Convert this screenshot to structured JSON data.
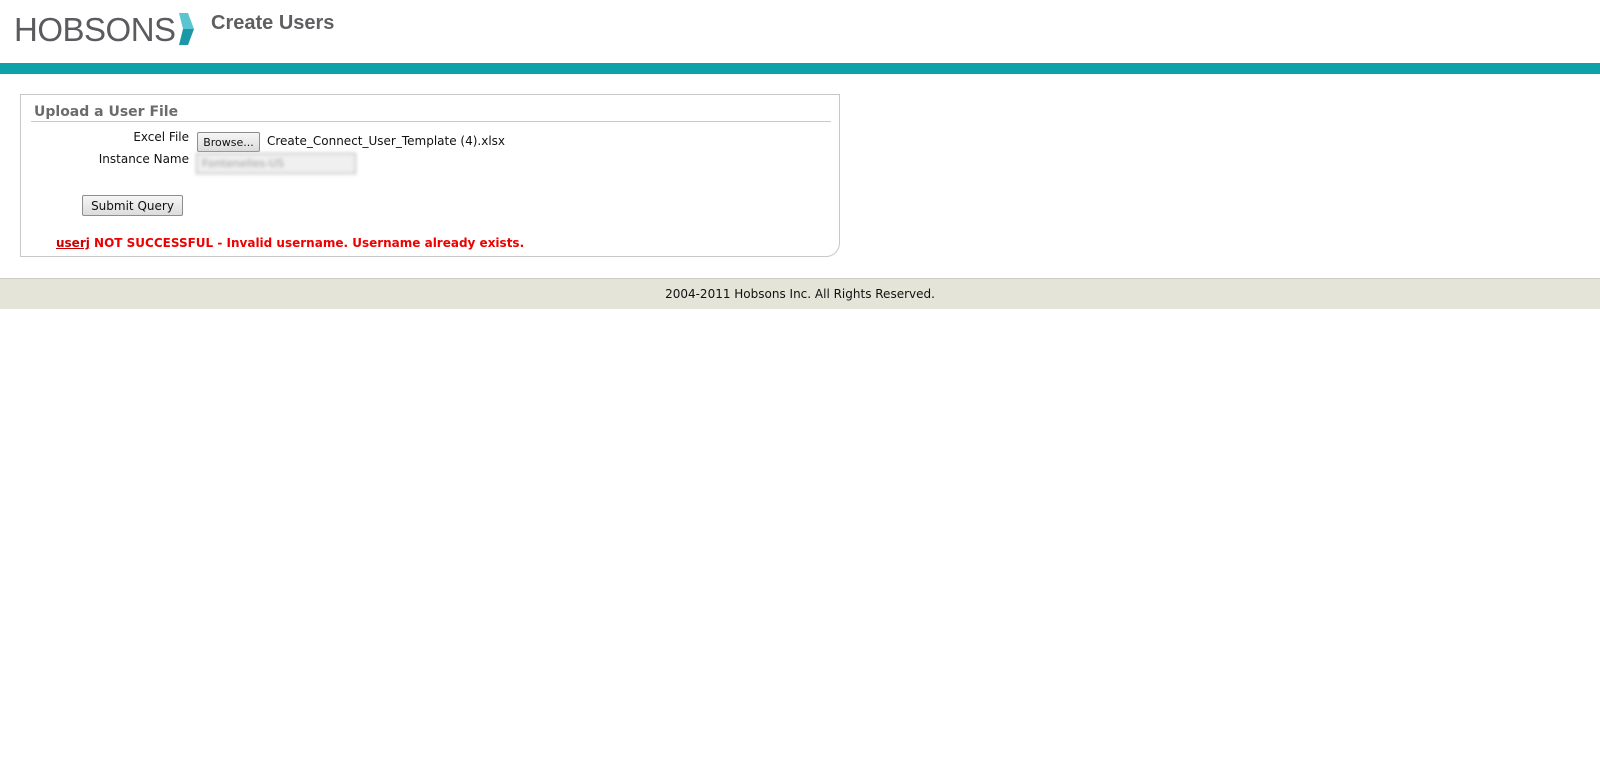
{
  "header": {
    "logo_text": "HOBSONS",
    "page_title": "Create Users"
  },
  "colors": {
    "accent_teal": "#0ea1aa",
    "error_red": "#ee0000",
    "footer_bg": "#e5e4d9"
  },
  "upload_panel": {
    "title": "Upload a User File",
    "excel_file_label": "Excel File",
    "browse_button_label": "Browse...",
    "selected_file_name": "Create_Connect_User_Template (4).xlsx",
    "instance_name_label": "Instance Name",
    "instance_name_value": "Fontenelles-US",
    "submit_button_label": "Submit Query",
    "error": {
      "username": "userj",
      "message": " NOT SUCCESSFUL - Invalid username. Username already exists."
    }
  },
  "footer": {
    "copyright": "2004-2011 Hobsons Inc. All Rights Reserved."
  }
}
